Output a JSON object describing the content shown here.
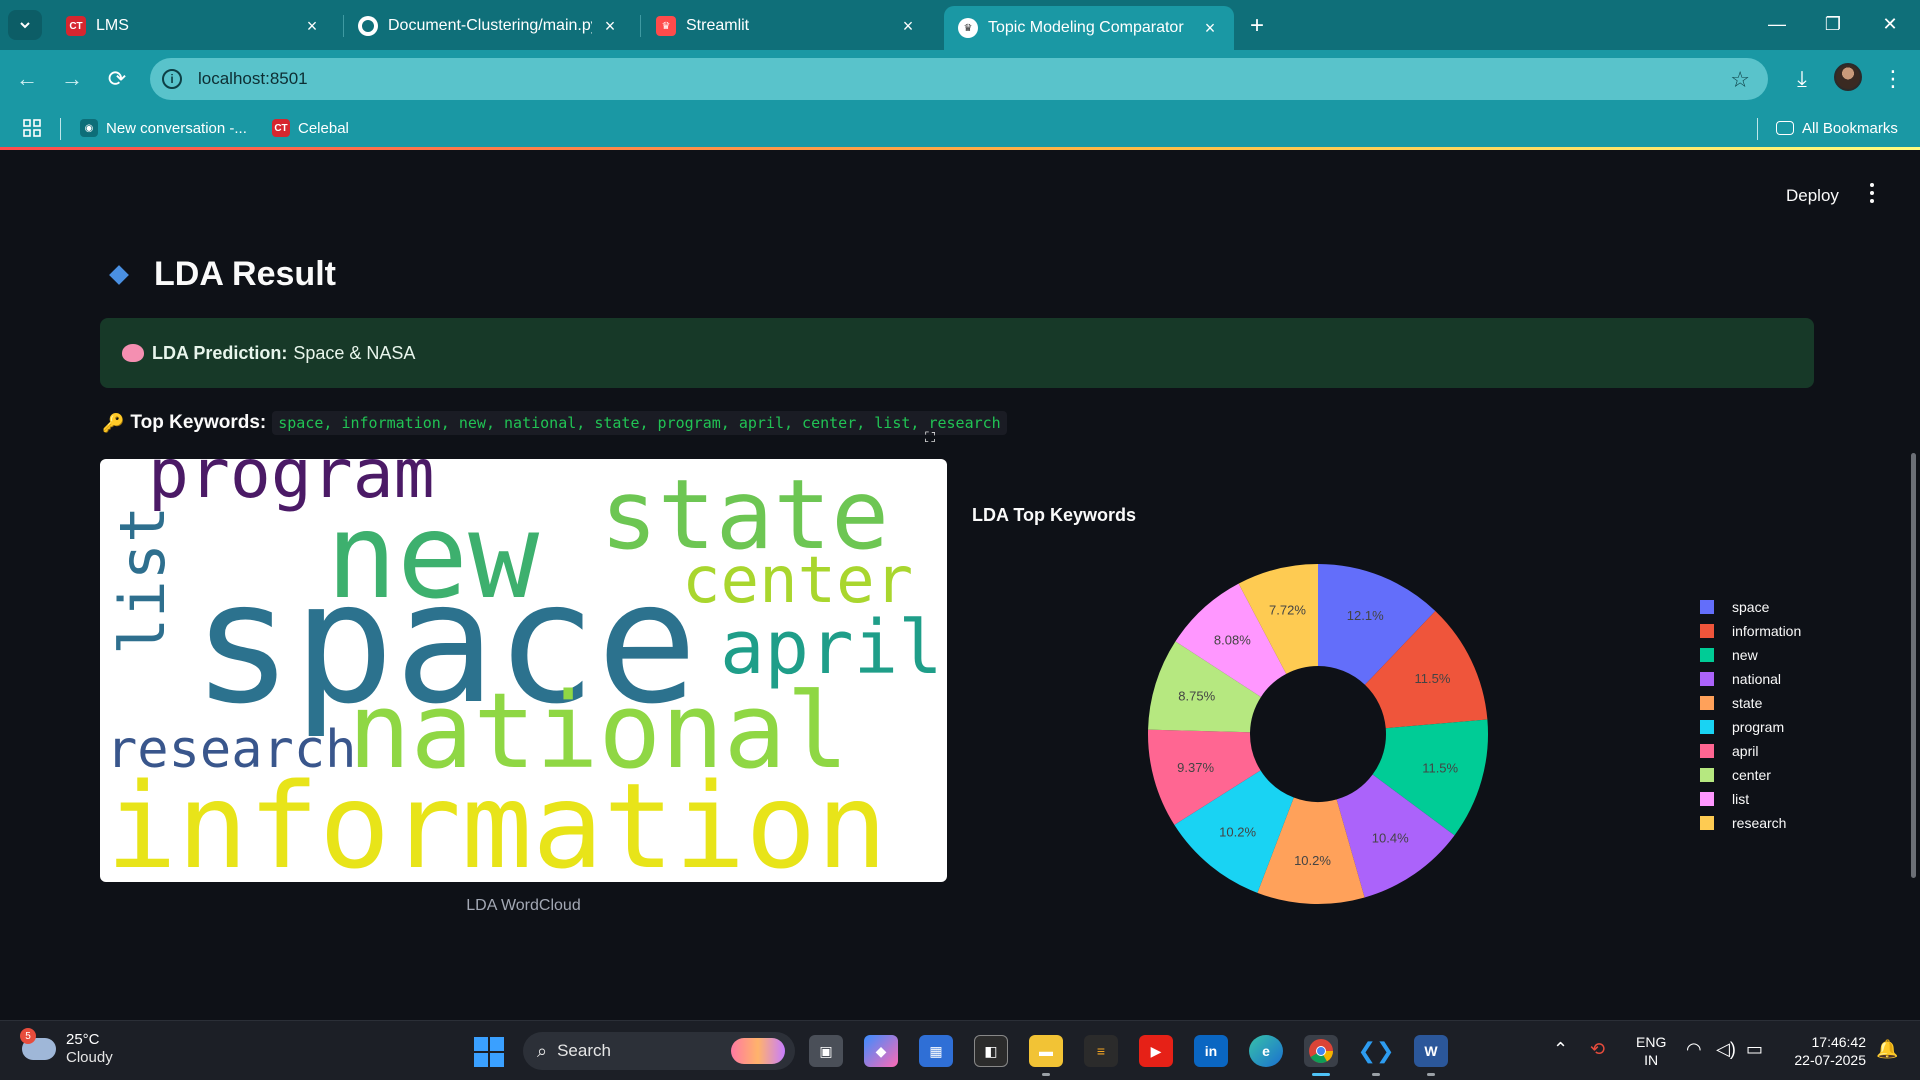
{
  "browser": {
    "tabs": [
      {
        "title": "LMS",
        "favicon": "celebal-icon",
        "active": false
      },
      {
        "title": "Document-Clustering/main.py",
        "favicon": "github-icon",
        "active": false
      },
      {
        "title": "Streamlit",
        "favicon": "streamlit-icon",
        "active": false
      },
      {
        "title": "Topic Modeling Comparator",
        "favicon": "streamlit-crown-icon",
        "active": true
      }
    ],
    "url": "localhost:8501",
    "bookmarks": [
      {
        "label": "New conversation -...",
        "icon": "copilot-icon"
      },
      {
        "label": "Celebal",
        "icon": "celebal-icon"
      }
    ],
    "all_bookmarks_label": "All Bookmarks"
  },
  "app": {
    "deploy_label": "Deploy",
    "heading": "LDA Result",
    "prediction": {
      "label": "LDA Prediction:",
      "value": "Space & NASA"
    },
    "keywords": {
      "label": "Top Keywords:",
      "value": "space, information, new, national, state, program, april, center, list, research"
    },
    "wordcloud_caption": "LDA WordCloud",
    "wordcloud_words": [
      "program",
      "new",
      "state",
      "center",
      "list",
      "space",
      "april",
      "research",
      "national",
      "information"
    ]
  },
  "chart_data": {
    "type": "pie",
    "hole": true,
    "title": "LDA Top Keywords",
    "categories": [
      "space",
      "information",
      "new",
      "national",
      "state",
      "program",
      "april",
      "center",
      "list",
      "research"
    ],
    "values": [
      12.1,
      11.5,
      11.5,
      10.4,
      10.2,
      10.2,
      9.37,
      8.75,
      8.08,
      7.72
    ],
    "labels": [
      "12.1%",
      "11.5%",
      "11.5%",
      "10.4%",
      "10.2%",
      "10.2%",
      "9.37%",
      "8.75%",
      "8.08%",
      "7.72%"
    ],
    "colors": [
      "#636efa",
      "#ef553b",
      "#00cc96",
      "#ab63fa",
      "#ffa15a",
      "#19d3f3",
      "#ff6692",
      "#b6e880",
      "#ff97ff",
      "#fecb52"
    ],
    "legend_position": "right"
  },
  "taskbar": {
    "weather": {
      "temp": "25°C",
      "condition": "Cloudy",
      "badge": "5"
    },
    "search_placeholder": "Search",
    "lang": [
      "ENG",
      "IN"
    ],
    "time": "17:46:42",
    "date": "22-07-2025"
  }
}
